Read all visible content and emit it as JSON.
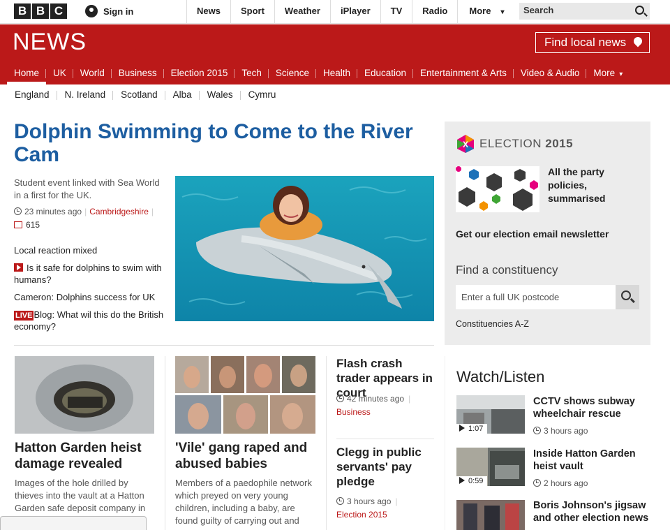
{
  "topbar": {
    "logo_letters": [
      "B",
      "B",
      "C"
    ],
    "signin": "Sign in",
    "nav": [
      "News",
      "Sport",
      "Weather",
      "iPlayer",
      "TV",
      "Radio"
    ],
    "more": "More",
    "search": "Search"
  },
  "masthead": {
    "brand": "NEWS",
    "find_local": "Find local news"
  },
  "section_nav": [
    "Home",
    "UK",
    "World",
    "Business",
    "Election 2015",
    "Tech",
    "Science",
    "Health",
    "Education",
    "Entertainment & Arts",
    "Video & Audio"
  ],
  "section_more": "More",
  "region_nav": [
    "England",
    "N. Ireland",
    "Scotland",
    "Alba",
    "Wales",
    "Cymru"
  ],
  "lead": {
    "headline": "Dolphin Swimming to Come to the River Cam",
    "summary": "Student event linked with Sea World in a first for the UK.",
    "time": "23 minutes ago",
    "tag": "Cambridgeshire",
    "comments": "615",
    "related": [
      {
        "text": "Local reaction mixed"
      },
      {
        "text": "Is it safe for dolphins to swim with humans?"
      },
      {
        "text": "Cameron: Dolphins success for UK"
      },
      {
        "text": "Blog: What wil this do the British economy?",
        "badge": "LIVE"
      }
    ]
  },
  "cards": [
    {
      "title": "Hatton Garden heist damage revealed",
      "summary": "Images of the hole drilled by thieves into the vault at a Hatton Garden safe deposit company in"
    },
    {
      "title": "'Vile' gang raped and abused babies",
      "summary": "Members of a paedophile network which preyed on very young children, including a baby, are found guilty of carrying out and"
    }
  ],
  "mid_stories": [
    {
      "title": "Flash crash trader appears in court",
      "time": "42 minutes ago",
      "tag": "Business"
    },
    {
      "title": "Clegg in public servants' pay pledge",
      "time": "3 hours ago",
      "tag": "Election 2015"
    }
  ],
  "election": {
    "logo": "ELECTION",
    "logo_year": "2015",
    "party_text": "All the party policies, summarised",
    "newsletter": "Get our election email newsletter",
    "find_constituency": "Find a constituency",
    "postcode_placeholder": "Enter a full UK postcode",
    "constituencies_az": "Constituencies A-Z"
  },
  "watch": {
    "title": "Watch/Listen",
    "items": [
      {
        "title": "CCTV shows subway wheelchair rescue",
        "time": "3 hours ago",
        "duration": "1:07"
      },
      {
        "title": "Inside Hatton Garden heist vault",
        "time": "2 hours ago",
        "duration": "0:59"
      },
      {
        "title": "Boris Johnson's jigsaw and other election news",
        "time": "",
        "duration": ""
      }
    ]
  },
  "colors": {
    "brand_red": "#bb1919",
    "headline_blue": "#1d5ea1",
    "panel_grey": "#ececec"
  }
}
